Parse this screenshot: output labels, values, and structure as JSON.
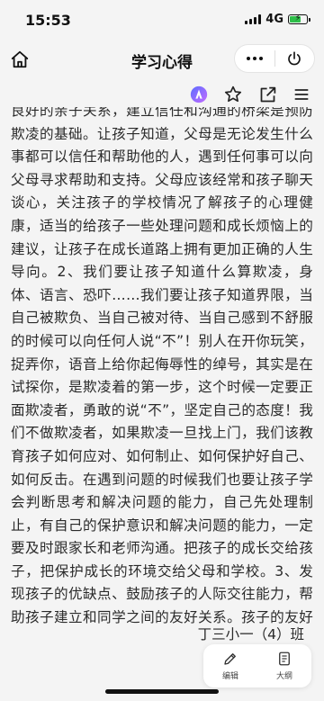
{
  "status_bar": {
    "time": "15:53",
    "network": "4G"
  },
  "nav": {
    "title": "学习心得"
  },
  "toolbar": {
    "icons": [
      "ai-assistant-icon",
      "star-icon",
      "share-icon",
      "menu-icon"
    ]
  },
  "article": {
    "text": "良好的亲子关系，建立信任和沟通的桥梁是预防欺凌的基础。让孩子知道，父母是无论发生什么事都可以信任和帮助他的人，遇到任何事可以向父母寻求帮助和支持。父母应该经常和孩子聊天谈心，关注孩子的学校情况了解孩子的心理健康，适当的给孩子一些处理问题和成长烦恼上的建议，让孩子在成长道路上拥有更加正确的人生导向。2、我们要让孩子知道什么算欺凌，身体、语言、恐吓……我们要让孩子知道界限，当自己被欺负、当自己被对待、当自己感到不舒服的时候可以向任何人说“不”！别人在开你玩笑，捉弄你，语音上给你起侮辱性的绰号，其实是在试探你，是欺凌着的第一步，这个时候一定要正面欺凌者，勇敢的说“不”，坚定自己的态度！我们不做欺凌者，如果欺凌一旦找上门，我们该教育孩子如何应对、如何制止、如何保护好自己、如何反击。在遇到问题的时候我们也要让孩子学会判断思考和解决问题的能力，自己先处理制止，有自己的保护意识和解决问题的能力，一定要及时跟家长和老师沟通。把孩子的成长交给孩子，把保护成长的环境交给父母和学校。3、发现孩子的优缺点、鼓励孩子的人际交往能力，帮助孩子建立和同学之间的友好关系。孩子的友好关系也可以大大减少被欺凌的发生。父母可以引导孩子尊重他人和热爱自己，让孩子学会与他人和平相处、助人为乐、团结友爱。逆风解意，向阳生长。",
    "signature": "丁三小一（4）班"
  },
  "floating_bar": {
    "edit_label": "编辑",
    "outline_label": "大纲"
  },
  "colors": {
    "background": "#f4f4f4",
    "battery": "#2fbf4a",
    "ai_gradient_start": "#5b6cff",
    "ai_gradient_end": "#c46bff"
  }
}
